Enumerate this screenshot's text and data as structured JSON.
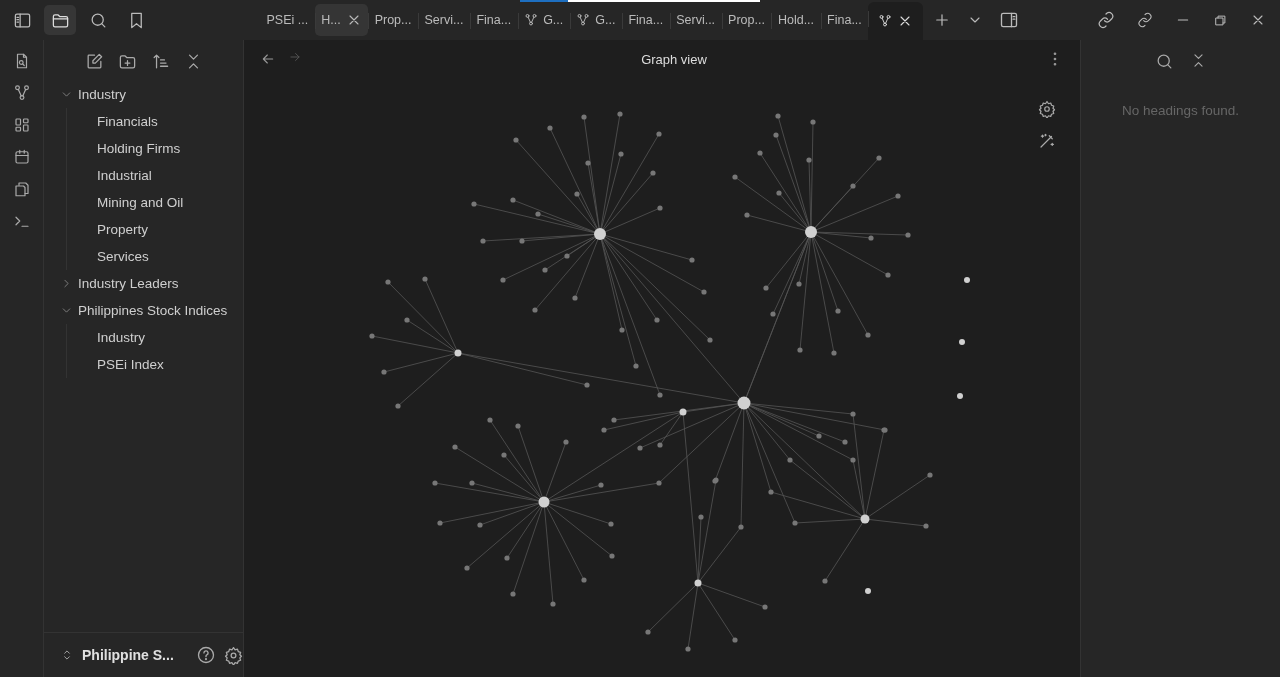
{
  "sidebar_tabs": [
    {
      "selected": true
    },
    {
      "selected": false
    },
    {
      "selected": false
    }
  ],
  "tabs": [
    {
      "label": "PSEi ...",
      "kind": "note",
      "selected": false,
      "hovered": false
    },
    {
      "label": "H...",
      "kind": "note",
      "selected": false,
      "hovered": true
    },
    {
      "label": "Prop...",
      "kind": "note",
      "selected": false,
      "hovered": false
    },
    {
      "label": "Servi...",
      "kind": "note",
      "selected": false,
      "hovered": false
    },
    {
      "label": "Fina...",
      "kind": "note",
      "selected": false,
      "hovered": false
    },
    {
      "label": "G...",
      "kind": "graph",
      "selected": false,
      "hovered": false
    },
    {
      "label": "G...",
      "kind": "graph",
      "selected": false,
      "hovered": false
    },
    {
      "label": "Fina...",
      "kind": "note",
      "selected": false,
      "hovered": false
    },
    {
      "label": "Servi...",
      "kind": "note",
      "selected": false,
      "hovered": false
    },
    {
      "label": "Prop...",
      "kind": "note",
      "selected": false,
      "hovered": false
    },
    {
      "label": "Hold...",
      "kind": "note",
      "selected": false,
      "hovered": false
    },
    {
      "label": "Fina...",
      "kind": "note",
      "selected": false,
      "hovered": false
    },
    {
      "kind": "graph",
      "selected": true,
      "hovered": false
    }
  ],
  "file_tree": [
    {
      "label": "Industry",
      "kind": "folder",
      "expanded": true,
      "children": [
        {
          "label": "Financials",
          "kind": "file"
        },
        {
          "label": "Holding Firms",
          "kind": "file"
        },
        {
          "label": "Industrial",
          "kind": "file"
        },
        {
          "label": "Mining and Oil",
          "kind": "file"
        },
        {
          "label": "Property",
          "kind": "file"
        },
        {
          "label": "Services",
          "kind": "file"
        }
      ]
    },
    {
      "label": "Industry Leaders",
      "kind": "folder",
      "expanded": false
    },
    {
      "label": "Philippines Stock Indices",
      "kind": "folder",
      "expanded": true,
      "children": [
        {
          "label": "Industry",
          "kind": "file"
        },
        {
          "label": "PSEi Index",
          "kind": "file"
        }
      ]
    }
  ],
  "vault": {
    "name": "Philippine S..."
  },
  "graph_view": {
    "title": "Graph view",
    "forward_disabled": true
  },
  "outline": {
    "empty_text": "No headings found."
  },
  "progress": {
    "level": 0.2
  }
}
